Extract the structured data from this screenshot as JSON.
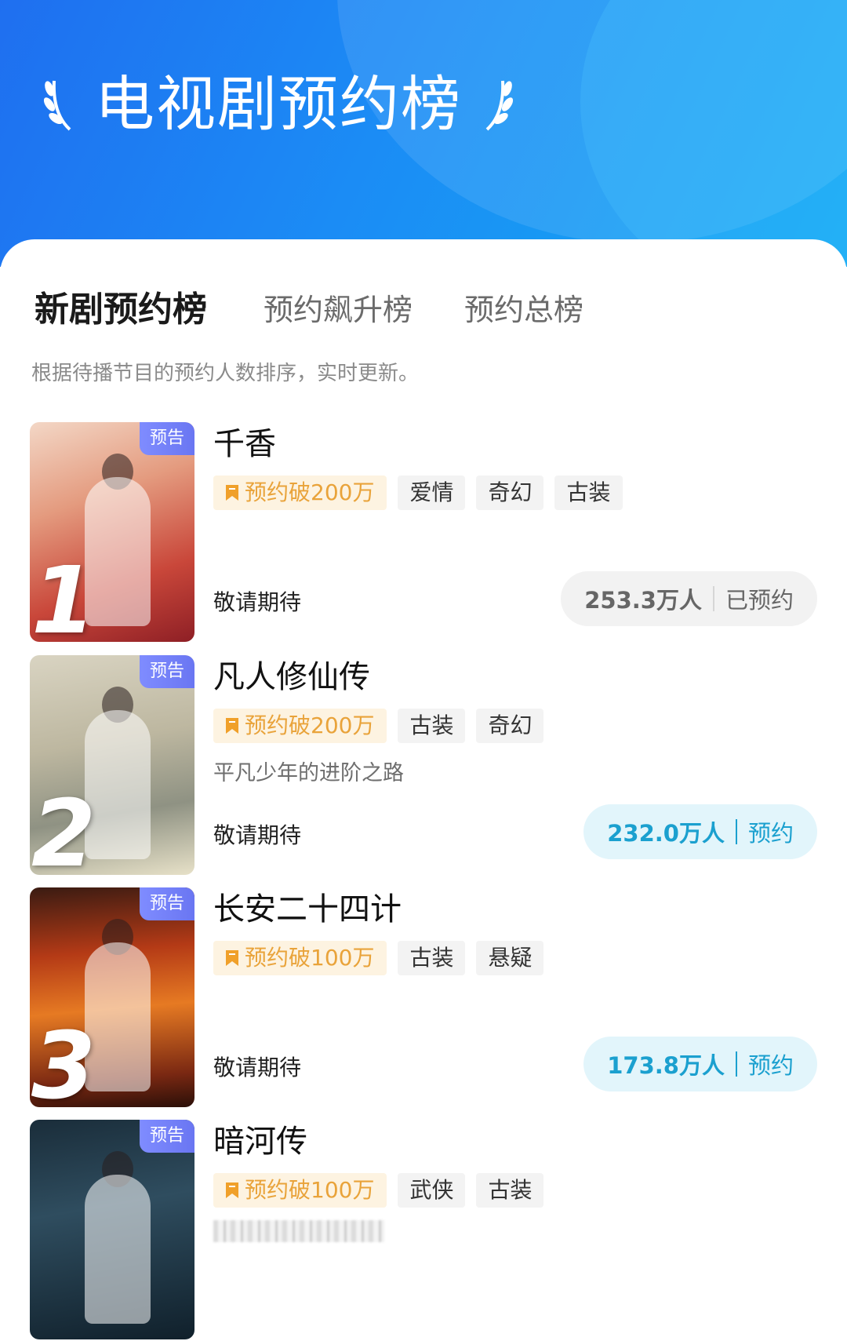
{
  "header": {
    "title": "电视剧预约榜",
    "colors": {
      "gradient_start": "#1f6ff0",
      "gradient_end": "#14a9f3"
    }
  },
  "tabs": [
    {
      "label": "新剧预约榜",
      "active": true
    },
    {
      "label": "预约飙升榜",
      "active": false
    },
    {
      "label": "预约总榜",
      "active": false
    }
  ],
  "description": "根据待播节目的预约人数排序，实时更新。",
  "items": [
    {
      "rank": "1",
      "corner": "预告",
      "title": "千香",
      "hot_tag": "预约破200万",
      "tags": [
        "爱情",
        "奇幻",
        "古装"
      ],
      "subtitle": "",
      "status": "敬请期待",
      "count": "253.3万人",
      "action": "已预约",
      "booked": true
    },
    {
      "rank": "2",
      "corner": "预告",
      "title": "凡人修仙传",
      "hot_tag": "预约破200万",
      "tags": [
        "古装",
        "奇幻"
      ],
      "subtitle": "平凡少年的进阶之路",
      "status": "敬请期待",
      "count": "232.0万人",
      "action": "预约",
      "booked": false
    },
    {
      "rank": "3",
      "corner": "预告",
      "title": "长安二十四计",
      "hot_tag": "预约破100万",
      "tags": [
        "古装",
        "悬疑"
      ],
      "subtitle": "",
      "status": "敬请期待",
      "count": "173.8万人",
      "action": "预约",
      "booked": false
    },
    {
      "rank": "",
      "corner": "预告",
      "title": "暗河传",
      "hot_tag": "预约破100万",
      "tags": [
        "武侠",
        "古装"
      ],
      "subtitle": "",
      "status": "",
      "count": "",
      "action": "",
      "booked": false
    }
  ]
}
